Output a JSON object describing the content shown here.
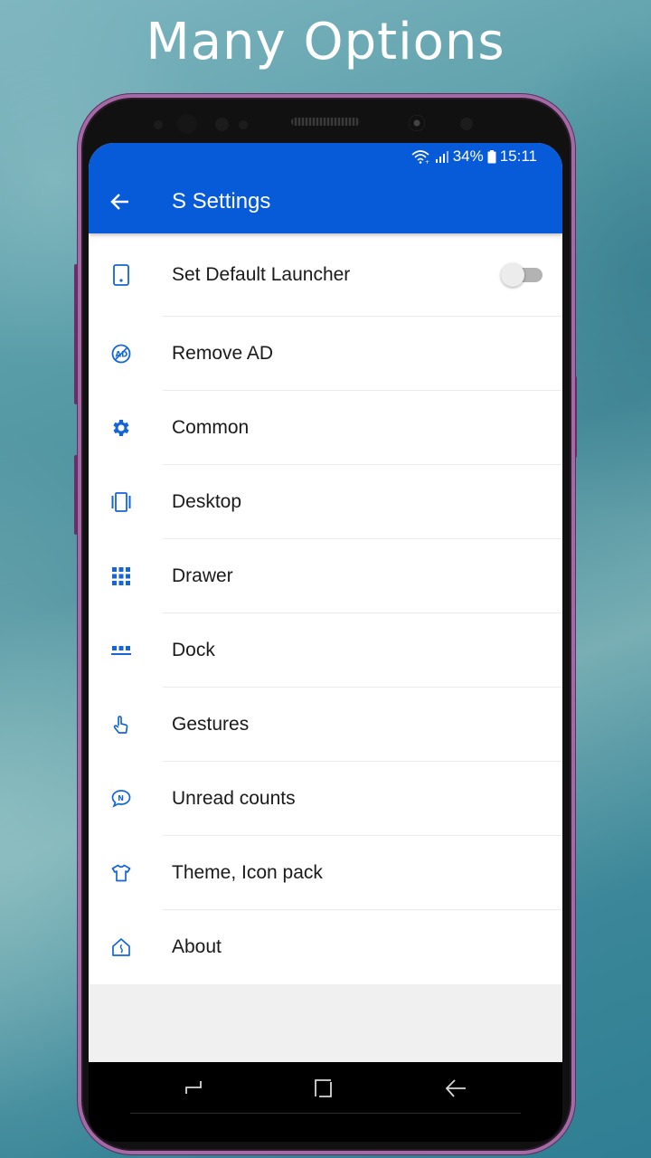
{
  "promo": {
    "headline": "Many Options"
  },
  "status_bar": {
    "battery_percent": "34%",
    "time": "15:11",
    "icons": [
      "wifi-icon",
      "signal-icon",
      "battery-icon"
    ]
  },
  "app_bar": {
    "back_icon": "arrow-left-icon",
    "title": "S Settings",
    "color": "#075ad8"
  },
  "settings": {
    "accent_color": "#1565d8",
    "items": [
      {
        "label": "Set Default Launcher",
        "icon": "phone-icon",
        "toggle": {
          "on": false
        }
      },
      {
        "label": "Remove AD",
        "icon": "no-ad-icon"
      },
      {
        "label": "Common",
        "icon": "gear-icon"
      },
      {
        "label": "Desktop",
        "icon": "desktop-pages-icon"
      },
      {
        "label": "Drawer",
        "icon": "app-grid-icon"
      },
      {
        "label": "Dock",
        "icon": "dock-icon"
      },
      {
        "label": "Gestures",
        "icon": "hand-pointer-icon"
      },
      {
        "label": "Unread counts",
        "icon": "notification-bubble-icon"
      },
      {
        "label": "Theme, Icon pack",
        "icon": "tshirt-icon"
      },
      {
        "label": "About",
        "icon": "house-info-icon"
      }
    ]
  },
  "nav_bar": {
    "buttons": [
      "recents-icon",
      "home-icon",
      "back-icon"
    ]
  }
}
